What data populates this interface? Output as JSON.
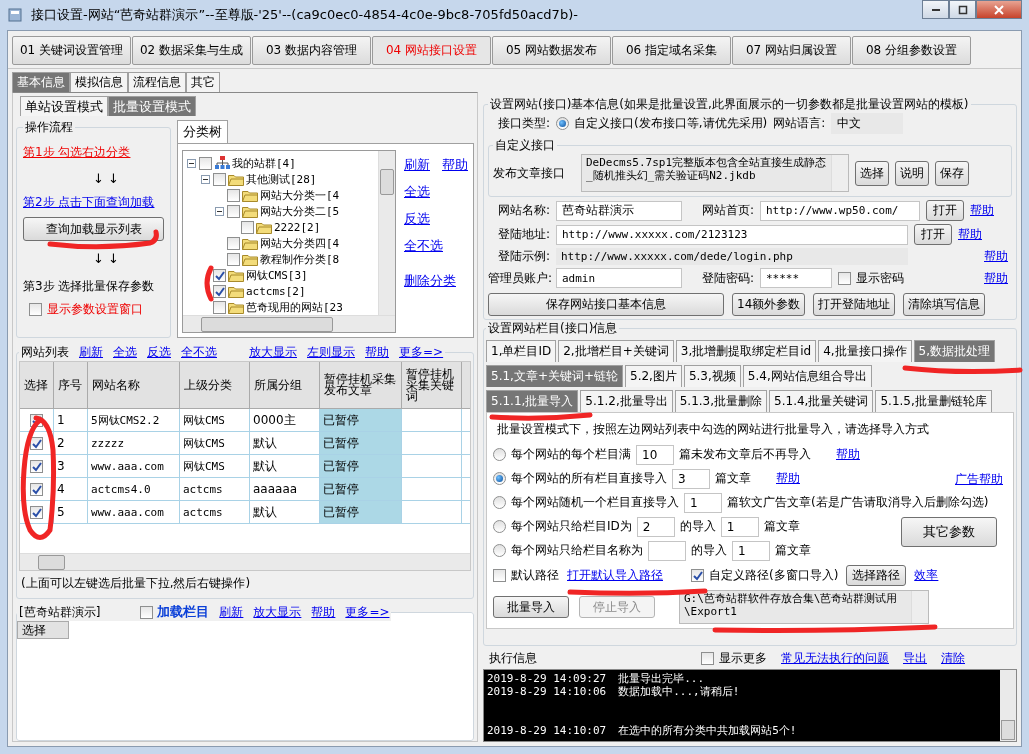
{
  "window": {
    "title": "接口设置-网站“芭奇站群演示”--至尊版-'25'--(ca9c0ec0-4854-4c0e-9bc8-705fd50acd7b)-"
  },
  "main_tabs": [
    {
      "label": "01 关键词设置管理",
      "selected": false
    },
    {
      "label": "02 数据采集与生成",
      "selected": false
    },
    {
      "label": "03 数据内容管理",
      "selected": false
    },
    {
      "label": "04 网站接口设置",
      "selected": true
    },
    {
      "label": "05 网站数据发布",
      "selected": false
    },
    {
      "label": "06 指定域名采集",
      "selected": false
    },
    {
      "label": "07 网站归属设置",
      "selected": false
    },
    {
      "label": "08 分组参数设置",
      "selected": false
    }
  ],
  "sub_tabs": [
    {
      "label": "基本信息",
      "selected": true
    },
    {
      "label": "模拟信息",
      "selected": false
    },
    {
      "label": "流程信息",
      "selected": false
    },
    {
      "label": "其它",
      "selected": false
    }
  ],
  "mode_tabs": [
    {
      "label": "单站设置模式",
      "selected": false
    },
    {
      "label": "批量设置模式",
      "selected": true
    }
  ],
  "workflow": {
    "title": "操作流程",
    "step1": "第1步  勾选右边分类",
    "arrows_1": "↓  ↓",
    "step2": "第2步  点击下面查询加载",
    "query_button": "查询加载显示列表",
    "arrows_2": "↓  ↓",
    "step3": "第3步  选择批量保存参数",
    "show_params": {
      "label": "显示参数设置窗口",
      "checked": false
    }
  },
  "category_tree": {
    "tab": "分类树",
    "nodes": [
      {
        "label": "我的站群[4]",
        "checked": false,
        "expanded": true,
        "children": [
          {
            "label": "其他测试[28]",
            "checked": false,
            "expanded": true,
            "children": [
              {
                "label": "网站大分类一[4",
                "checked": false
              },
              {
                "label": "网站大分类二[5",
                "checked": false,
                "expanded": true,
                "children": [
                  {
                    "label": "2222[2]",
                    "checked": false
                  }
                ]
              },
              {
                "label": "网站大分类四[4",
                "checked": false
              },
              {
                "label": "教程制作分类[8",
                "checked": false
              }
            ]
          },
          {
            "label": "网钛CMS[3]",
            "checked": true
          },
          {
            "label": "actcms[2]",
            "checked": true
          },
          {
            "label": "芭奇现用的网站[23",
            "checked": false
          }
        ]
      }
    ],
    "links": [
      "刷新",
      "帮助",
      "全选",
      "反选",
      "全不选",
      "删除分类"
    ]
  },
  "site_list": {
    "title": "网站列表",
    "links": [
      "刷新",
      "全选",
      "反选",
      "全不选",
      "放大显示",
      "左则显示",
      "帮助",
      "更多=>"
    ],
    "select_column": "选择",
    "columns": [
      "序号",
      "网站名称",
      "上级分类",
      "所属分组",
      "暂停挂机采集发布文章",
      "暂停挂机采集关键词"
    ],
    "rows": [
      {
        "checked": true,
        "cells": [
          "1",
          "5网钛CMS2.2",
          "网钛CMS",
          "0000主",
          "已暂停"
        ]
      },
      {
        "checked": true,
        "cells": [
          "2",
          "zzzzz",
          "网钛CMS",
          "默认",
          "已暂停"
        ]
      },
      {
        "checked": true,
        "cells": [
          "3",
          "www.aaa.com",
          "网钛CMS",
          "默认",
          "已暂停"
        ]
      },
      {
        "checked": true,
        "cells": [
          "4",
          "actcms4.0",
          "actcms",
          "aaaaaa",
          "已暂停"
        ]
      },
      {
        "checked": true,
        "cells": [
          "5",
          "www.aaa.com",
          "actcms",
          "默认",
          "已暂停"
        ]
      }
    ],
    "note": "(上面可以左键选后批量下拉,然后右键操作)"
  },
  "column_panel": {
    "title": "[芭奇站群演示]",
    "load_columns": {
      "label": "加载栏目",
      "checked": false
    },
    "links": [
      "刷新",
      "放大显示",
      "帮助",
      "更多=>"
    ],
    "column": "选择"
  },
  "basic_info": {
    "title": "设置网站(接口)基本信息(如果是批量设置,此界面展示的一切参数都是批量设置网站的模板)",
    "interface_type_label": "接口类型:",
    "interface_type": {
      "label": "自定义接口(发布接口等,请优先采用)",
      "selected": true
    },
    "language_label": "网站语言:",
    "language": "中文",
    "custom_group": "自定义接口",
    "publish_label": "发布文章接口",
    "publish_file": "DeDecms5.7sp1完整版本包含全站直接生成静态_随机推头幻_需关验证码N2.jkdb",
    "file_buttons": [
      "选择",
      "说明",
      "保存"
    ],
    "site_name_label": "网站名称:",
    "site_name": "芭奇站群演示",
    "home_label": "网站首页:",
    "home": "http://www.wp50.com/",
    "open_button": "打开",
    "help": "帮助",
    "login_label": "登陆地址:",
    "login": "http://www.xxxxx.com/2123123",
    "open_button_2": "打开",
    "help_2": "帮助",
    "example_label": "登陆示例:",
    "example": "http://www.xxxxx.com/dede/login.php",
    "help_3": "帮助",
    "admin_label": "管理员账户:",
    "admin": "admin",
    "password_label": "登陆密码:",
    "password": "*****",
    "show_password": {
      "label": "显示密码",
      "checked": false
    },
    "help_4": "帮助",
    "buttons": [
      "保存网站接口基本信息",
      "14额外参数",
      "打开登陆地址",
      "清除填写信息"
    ]
  },
  "column_info": {
    "title": "设置网站栏目(接口)信息",
    "tabs": [
      {
        "label": "1,单栏目ID",
        "selected": false
      },
      {
        "label": "2,批增栏目+关键词",
        "selected": false
      },
      {
        "label": "3,批增删提取绑定栏目id",
        "selected": false
      },
      {
        "label": "4,批量接口操作",
        "selected": false
      },
      {
        "label": "5,数据批处理",
        "selected": true
      }
    ],
    "tabs_2": [
      {
        "label": "5.1,文章+关键词+链轮",
        "selected": true
      },
      {
        "label": "5.2,图片",
        "selected": false
      },
      {
        "label": "5.3,视频",
        "selected": false
      },
      {
        "label": "5.4,网站信息组合导出",
        "selected": false
      }
    ],
    "tabs_3": [
      {
        "label": "5.1.1,批量导入",
        "selected": true
      },
      {
        "label": "5.1.2,批量导出",
        "selected": false
      },
      {
        "label": "5.1.3,批量删除",
        "selected": false
      },
      {
        "label": "5.1.4,批量关键词",
        "selected": false
      },
      {
        "label": "5.1.5,批量删链轮库",
        "selected": false
      }
    ],
    "intro": "批量设置模式下，按照左边网站列表中勾选的网站进行批量导入，请选择导入方式",
    "options": [
      {
        "selected": false,
        "parts": [
          {
            "kind": "text",
            "text": "每个网站的每个栏目满"
          },
          {
            "kind": "input",
            "value": "10"
          },
          {
            "kind": "text",
            "text": "篇未发布文章后不再导入"
          },
          {
            "kind": "link",
            "text": "帮助"
          }
        ]
      },
      {
        "selected": true,
        "parts": [
          {
            "kind": "text",
            "text": "每个网站的所有栏目直接导入"
          },
          {
            "kind": "input",
            "value": "3"
          },
          {
            "kind": "text",
            "text": "篇文章"
          },
          {
            "kind": "link",
            "text": "帮助"
          }
        ]
      },
      {
        "selected": false,
        "parts": [
          {
            "kind": "text",
            "text": "每个网站随机一个栏目直接导入"
          },
          {
            "kind": "input",
            "value": "1"
          },
          {
            "kind": "text",
            "text": "篇软文广告文章(若是广告请取消导入后删除勾选)"
          }
        ]
      },
      {
        "selected": false,
        "parts": [
          {
            "kind": "text",
            "text": "每个网站只给栏目ID为"
          },
          {
            "kind": "input",
            "value": "2"
          },
          {
            "kind": "text",
            "text": "的导入"
          },
          {
            "kind": "input",
            "value": "1"
          },
          {
            "kind": "text",
            "text": "篇文章"
          }
        ]
      },
      {
        "selected": false,
        "parts": [
          {
            "kind": "text",
            "text": "每个网站只给栏目名称为"
          },
          {
            "kind": "input"
          },
          {
            "kind": "text",
            "text": "的导入"
          },
          {
            "kind": "input",
            "value": "1"
          },
          {
            "kind": "text",
            "text": "篇文章"
          }
        ]
      }
    ],
    "ad_help": "广告帮助",
    "other_params": "其它参数",
    "default_path": {
      "label": "默认路径",
      "checked": false
    },
    "open_default_path": "打开默认导入路径",
    "custom_path": {
      "label": "自定义路径(多窗口导入)",
      "checked": true
    },
    "choose_path": "选择路径",
    "efficiency": "效率",
    "path": "G:\\芭奇站群软件存放合集\\芭奇站群测试用\\Export1",
    "import_button": "批量导入",
    "stop_button": {
      "label": "停止导入",
      "disabled": true
    }
  },
  "execution": {
    "title": "执行信息",
    "show_more": {
      "label": "显示更多",
      "checked": false
    },
    "links": [
      "常见无法执行的问题",
      "导出",
      "清除"
    ],
    "log": [
      {
        "time": "2019-8-29 14:09:27",
        "text": "批量导出完毕...",
        "gap_before": false
      },
      {
        "time": "2019-8-29 14:10:06",
        "text": "数据加载中...,请稍后!",
        "gap_before": false
      },
      {
        "time": "2019-8-29 14:10:07",
        "text": "在选中的所有分类中共加载网站5个!",
        "gap_before": true
      }
    ]
  }
}
